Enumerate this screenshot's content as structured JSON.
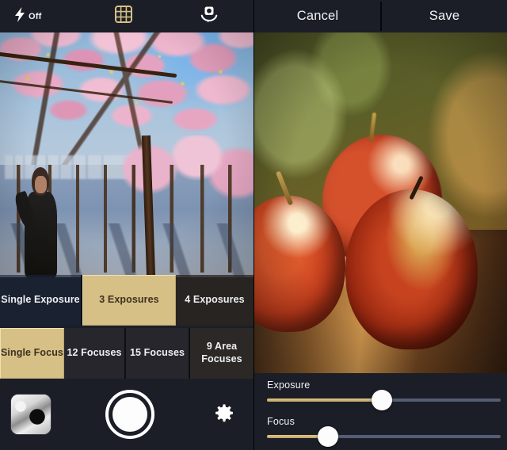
{
  "app": {
    "accent_selected": "#d7c086",
    "accent_track": "#d8c18a",
    "chrome_bg": "#1b1e27"
  },
  "camera_panel": {
    "topbar": {
      "flash": {
        "icon": "flash-icon",
        "label": "Off"
      },
      "grid": {
        "icon": "grid-icon"
      },
      "flip": {
        "icon": "camera-flip-icon"
      }
    },
    "viewfinder": {
      "description": "Live camera preview of cherry blossom trees lining a street with a person in a dark coat"
    },
    "exposure_modes": [
      {
        "label": "Single Exposure",
        "selected": false
      },
      {
        "label": "3 Exposures",
        "selected": true
      },
      {
        "label": "4 Exposures",
        "selected": false
      }
    ],
    "focus_modes": [
      {
        "label": "Single Focus",
        "selected": true
      },
      {
        "label": "12 Focuses",
        "selected": false
      },
      {
        "label": "15 Focuses",
        "selected": false
      },
      {
        "label": "9 Area Focuses",
        "selected": false
      }
    ],
    "bottombar": {
      "thumbnail": "last-photo-thumbnail",
      "shutter": "shutter-button",
      "settings": "gear-icon"
    }
  },
  "editor_panel": {
    "topbar": {
      "cancel_label": "Cancel",
      "save_label": "Save"
    },
    "preview": {
      "description": "Photo of three red apples on a wooden table with warm backlight and green bokeh background"
    },
    "sliders": [
      {
        "name": "Exposure",
        "label": "Exposure",
        "value_percent": 49
      },
      {
        "name": "Focus",
        "label": "Focus",
        "value_percent": 26
      }
    ]
  }
}
